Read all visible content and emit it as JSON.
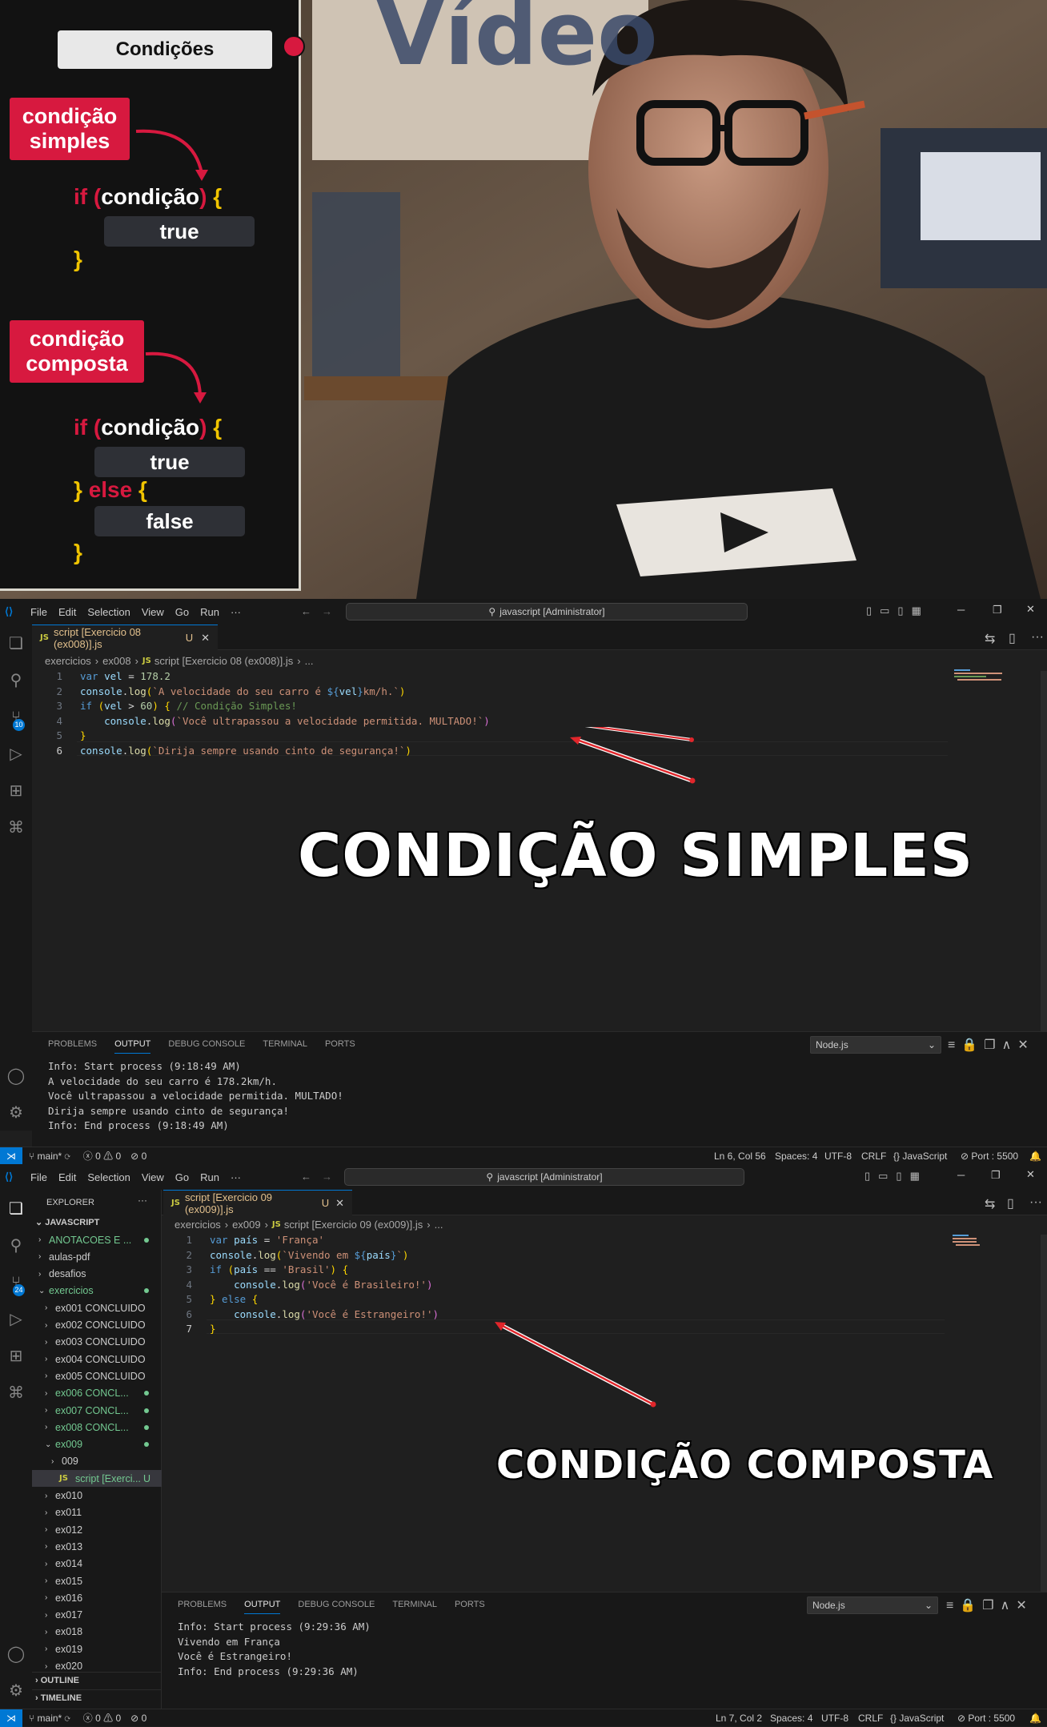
{
  "video": {
    "panel_title": "Condições",
    "tag_simple": [
      "condição",
      "simples"
    ],
    "tag_composite": [
      "condição",
      "composta"
    ],
    "simple_code": {
      "if": "if",
      "open_paren": "(",
      "cond": "condição",
      "close_paren": ")",
      "brace_open": "{",
      "true_box": "true",
      "brace_close": "}"
    },
    "composite_code": {
      "if": "if",
      "open_paren": "(",
      "cond": "condição",
      "close_paren": ")",
      "brace_open": "{",
      "true_box": "true",
      "else_close": "}",
      "else": "else",
      "else_open": "{",
      "false_box": "false",
      "brace_close": "}"
    },
    "wall_text": "Vídeo"
  },
  "editor1": {
    "menu": [
      "File",
      "Edit",
      "Selection",
      "View",
      "Go",
      "Run",
      "···"
    ],
    "command_center": "javascript [Administrator]",
    "source_control_badge": "10",
    "tab": {
      "label": "script [Exercicio 08 (ex008)].js",
      "status": "U"
    },
    "breadcrumbs": [
      "exercicios",
      "ex008",
      "script [Exercicio 08 (ex008)].js",
      "..."
    ],
    "code": [
      {
        "n": "1",
        "parts": [
          [
            "c-kw",
            "var "
          ],
          [
            "c-var",
            "vel"
          ],
          [
            "c-op",
            " = "
          ],
          [
            "c-num",
            "178.2"
          ]
        ]
      },
      {
        "n": "2",
        "parts": [
          [
            "c-var",
            "console"
          ],
          [
            "c-op",
            "."
          ],
          [
            "c-fn",
            "log"
          ],
          [
            "c-br1",
            "("
          ],
          [
            "c-str",
            "`A velocidade do seu carro é "
          ],
          [
            "c-tpl",
            "${"
          ],
          [
            "c-var",
            "vel"
          ],
          [
            "c-tpl",
            "}"
          ],
          [
            "c-str",
            "km/h.`"
          ],
          [
            "c-br1",
            ")"
          ]
        ]
      },
      {
        "n": "3",
        "parts": [
          [
            "c-kw",
            "if "
          ],
          [
            "c-br1",
            "("
          ],
          [
            "c-var",
            "vel"
          ],
          [
            "c-op",
            " > "
          ],
          [
            "c-num",
            "60"
          ],
          [
            "c-br1",
            ")"
          ],
          [
            "c-op",
            " "
          ],
          [
            "c-br1",
            "{"
          ],
          [
            "c-com",
            " // Condição Simples!"
          ]
        ]
      },
      {
        "n": "4",
        "parts": [
          [
            "c-op",
            "    "
          ],
          [
            "c-var",
            "console"
          ],
          [
            "c-op",
            "."
          ],
          [
            "c-fn",
            "log"
          ],
          [
            "c-br2",
            "("
          ],
          [
            "c-str",
            "`Você ultrapassou a velocidade permitida. MULTADO!`"
          ],
          [
            "c-br2",
            ")"
          ]
        ]
      },
      {
        "n": "5",
        "parts": [
          [
            "c-br1",
            "}"
          ]
        ]
      },
      {
        "n": "6",
        "parts": [
          [
            "c-var",
            "console"
          ],
          [
            "c-op",
            "."
          ],
          [
            "c-fn",
            "log"
          ],
          [
            "c-br1",
            "("
          ],
          [
            "c-str",
            "`Dirija sempre usando cinto de segurança!`"
          ],
          [
            "c-br1",
            ")"
          ]
        ]
      }
    ],
    "panel_tabs": [
      "PROBLEMS",
      "OUTPUT",
      "DEBUG CONSOLE",
      "TERMINAL",
      "PORTS"
    ],
    "output_channel": "Node.js",
    "output": [
      "Info: Start process (9:18:49 AM)",
      "A velocidade do seu carro é 178.2km/h.",
      "Você ultrapassou a velocidade permitida. MULTADO!",
      "Dirija sempre usando cinto de segurança!",
      "Info: End process (9:18:49 AM)"
    ],
    "overlay": "CONDIÇÃO SIMPLES",
    "status": {
      "branch": "main*",
      "errors": "0",
      "warnings": "0",
      "ports": "0",
      "position": "Ln 6, Col 56",
      "spaces": "Spaces: 4",
      "encoding": "UTF-8",
      "eol": "CRLF",
      "language": "JavaScript",
      "port": "Port : 5500"
    }
  },
  "editor2": {
    "menu": [
      "File",
      "Edit",
      "Selection",
      "View",
      "Go",
      "Run",
      "···"
    ],
    "command_center": "javascript [Administrator]",
    "source_control_badge": "24",
    "explorer_title": "EXPLORER",
    "workspace": "JAVASCRIPT",
    "tree": [
      {
        "label": "ANOTACOES E ...",
        "indent": 1,
        "chev": "›",
        "color": "#73c991",
        "dot": true
      },
      {
        "label": "aulas-pdf",
        "indent": 1,
        "chev": "›",
        "color": "#cccccc",
        "dot": false
      },
      {
        "label": "desafios",
        "indent": 1,
        "chev": "›",
        "color": "#cccccc",
        "dot": false
      },
      {
        "label": "exercicios",
        "indent": 1,
        "chev": "⌄",
        "color": "#73c991",
        "dot": true
      },
      {
        "label": "ex001 CONCLUIDO",
        "indent": 2,
        "chev": "›",
        "color": "#cccccc",
        "dot": false
      },
      {
        "label": "ex002 CONCLUIDO",
        "indent": 2,
        "chev": "›",
        "color": "#cccccc",
        "dot": false
      },
      {
        "label": "ex003 CONCLUIDO",
        "indent": 2,
        "chev": "›",
        "color": "#cccccc",
        "dot": false
      },
      {
        "label": "ex004 CONCLUIDO",
        "indent": 2,
        "chev": "›",
        "color": "#cccccc",
        "dot": false
      },
      {
        "label": "ex005 CONCLUIDO",
        "indent": 2,
        "chev": "›",
        "color": "#cccccc",
        "dot": false
      },
      {
        "label": "ex006 CONCL...",
        "indent": 2,
        "chev": "›",
        "color": "#73c991",
        "dot": true
      },
      {
        "label": "ex007 CONCL...",
        "indent": 2,
        "chev": "›",
        "color": "#73c991",
        "dot": true
      },
      {
        "label": "ex008 CONCL...",
        "indent": 2,
        "chev": "›",
        "color": "#73c991",
        "dot": true
      },
      {
        "label": "ex009",
        "indent": 2,
        "chev": "⌄",
        "color": "#73c991",
        "dot": true
      },
      {
        "label": "009",
        "indent": 3,
        "chev": "›",
        "color": "#cccccc",
        "dot": false
      },
      {
        "label": "script [Exerci...",
        "indent": 3,
        "chev": "",
        "color": "#73c991",
        "dot": false,
        "selected": true,
        "status": "U"
      },
      {
        "label": "ex010",
        "indent": 2,
        "chev": "›",
        "color": "#cccccc",
        "dot": false
      },
      {
        "label": "ex011",
        "indent": 2,
        "chev": "›",
        "color": "#cccccc",
        "dot": false
      },
      {
        "label": "ex012",
        "indent": 2,
        "chev": "›",
        "color": "#cccccc",
        "dot": false
      },
      {
        "label": "ex013",
        "indent": 2,
        "chev": "›",
        "color": "#cccccc",
        "dot": false
      },
      {
        "label": "ex014",
        "indent": 2,
        "chev": "›",
        "color": "#cccccc",
        "dot": false
      },
      {
        "label": "ex015",
        "indent": 2,
        "chev": "›",
        "color": "#cccccc",
        "dot": false
      },
      {
        "label": "ex016",
        "indent": 2,
        "chev": "›",
        "color": "#cccccc",
        "dot": false
      },
      {
        "label": "ex017",
        "indent": 2,
        "chev": "›",
        "color": "#cccccc",
        "dot": false
      },
      {
        "label": "ex018",
        "indent": 2,
        "chev": "›",
        "color": "#cccccc",
        "dot": false
      },
      {
        "label": "ex019",
        "indent": 2,
        "chev": "›",
        "color": "#cccccc",
        "dot": false
      },
      {
        "label": "ex020",
        "indent": 2,
        "chev": "›",
        "color": "#cccccc",
        "dot": false
      }
    ],
    "outline": "OUTLINE",
    "timeline": "TIMELINE",
    "tab": {
      "label": "script  [Exercicio 09 (ex009)].js",
      "status": "U"
    },
    "breadcrumbs": [
      "exercicios",
      "ex009",
      "script  [Exercicio 09 (ex009)].js",
      "..."
    ],
    "code": [
      {
        "n": "1",
        "parts": [
          [
            "c-kw",
            "var "
          ],
          [
            "c-var",
            "país"
          ],
          [
            "c-op",
            " = "
          ],
          [
            "c-str",
            "'França'"
          ]
        ]
      },
      {
        "n": "2",
        "parts": [
          [
            "c-var",
            "console"
          ],
          [
            "c-op",
            "."
          ],
          [
            "c-fn",
            "log"
          ],
          [
            "c-br1",
            "("
          ],
          [
            "c-str",
            "`Vivendo em "
          ],
          [
            "c-tpl",
            "${"
          ],
          [
            "c-var",
            "país"
          ],
          [
            "c-tpl",
            "}"
          ],
          [
            "c-str",
            "`"
          ],
          [
            "c-br1",
            ")"
          ]
        ]
      },
      {
        "n": "3",
        "parts": [
          [
            "c-kw",
            "if "
          ],
          [
            "c-br1",
            "("
          ],
          [
            "c-var",
            "país"
          ],
          [
            "c-op",
            " == "
          ],
          [
            "c-str",
            "'Brasil'"
          ],
          [
            "c-br1",
            ")"
          ],
          [
            "c-op",
            " "
          ],
          [
            "c-br1",
            "{"
          ]
        ]
      },
      {
        "n": "4",
        "parts": [
          [
            "c-op",
            "    "
          ],
          [
            "c-var",
            "console"
          ],
          [
            "c-op",
            "."
          ],
          [
            "c-fn",
            "log"
          ],
          [
            "c-br2",
            "("
          ],
          [
            "c-str",
            "'Você é Brasileiro!'"
          ],
          [
            "c-br2",
            ")"
          ]
        ]
      },
      {
        "n": "5",
        "parts": [
          [
            "c-br1",
            "}"
          ],
          [
            "c-kw",
            " else "
          ],
          [
            "c-br1",
            "{"
          ]
        ]
      },
      {
        "n": "6",
        "parts": [
          [
            "c-op",
            "    "
          ],
          [
            "c-var",
            "console"
          ],
          [
            "c-op",
            "."
          ],
          [
            "c-fn",
            "log"
          ],
          [
            "c-br2",
            "("
          ],
          [
            "c-str",
            "'Você é Estrangeiro!'"
          ],
          [
            "c-br2",
            ")"
          ]
        ]
      },
      {
        "n": "7",
        "parts": [
          [
            "c-br1",
            "}"
          ]
        ]
      }
    ],
    "panel_tabs": [
      "PROBLEMS",
      "OUTPUT",
      "DEBUG CONSOLE",
      "TERMINAL",
      "PORTS"
    ],
    "output_channel": "Node.js",
    "output": [
      "Info: Start process (9:29:36 AM)",
      "Vivendo em França",
      "Você é Estrangeiro!",
      "Info: End process (9:29:36 AM)"
    ],
    "overlay": "CONDIÇÃO COMPOSTA",
    "status": {
      "branch": "main*",
      "errors": "0",
      "warnings": "0",
      "ports": "0",
      "position": "Ln 7, Col 2",
      "spaces": "Spaces: 4",
      "encoding": "UTF-8",
      "eol": "CRLF",
      "language": "JavaScript",
      "port": "Port : 5500"
    }
  }
}
